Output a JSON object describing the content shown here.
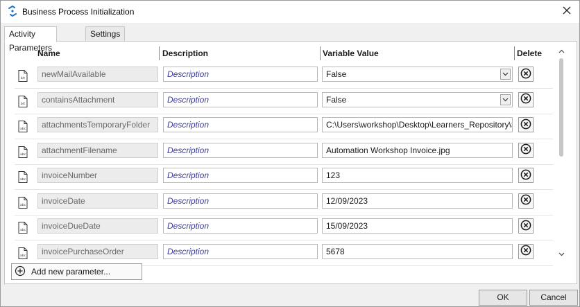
{
  "window": {
    "title": "Business Process Initialization",
    "app_icon": "uipath-arrows-icon",
    "close_icon": "close-icon"
  },
  "tabs": [
    {
      "label": "Activity Parameters",
      "active": true
    },
    {
      "label": "Settings",
      "active": false
    }
  ],
  "table": {
    "headers": {
      "name": "Name",
      "description": "Description",
      "value": "Variable Value",
      "delete": "Delete"
    },
    "rows": [
      {
        "icon": "boolean-file-icon",
        "name": "newMailAvailable",
        "description_placeholder": "Description",
        "value": "False",
        "is_combo": true
      },
      {
        "icon": "boolean-file-icon",
        "name": "containsAttachment",
        "description_placeholder": "Description",
        "value": "False",
        "is_combo": true
      },
      {
        "icon": "string-file-icon",
        "name": "attachmentsTemporaryFolder",
        "description_placeholder": "Description",
        "value": "C:\\Users\\workshop\\Desktop\\Learners_Repository\\S",
        "is_combo": false
      },
      {
        "icon": "string-file-icon",
        "name": "attachmentFilename",
        "description_placeholder": "Description",
        "value": "Automation Workshop Invoice.jpg",
        "is_combo": false
      },
      {
        "icon": "string-file-icon",
        "name": "invoiceNumber",
        "description_placeholder": "Description",
        "value": "123",
        "is_combo": false
      },
      {
        "icon": "string-file-icon",
        "name": "invoiceDate",
        "description_placeholder": "Description",
        "value": "12/09/2023",
        "is_combo": false
      },
      {
        "icon": "string-file-icon",
        "name": "invoiceDueDate",
        "description_placeholder": "Description",
        "value": "15/09/2023",
        "is_combo": false
      },
      {
        "icon": "string-file-icon",
        "name": "invoicePurchaseOrder",
        "description_placeholder": "Description",
        "value": "5678",
        "is_combo": false
      }
    ]
  },
  "add_parameter_label": "Add new parameter...",
  "buttons": {
    "ok": "OK",
    "cancel": "Cancel"
  },
  "colors": {
    "accent": "#1a73c8",
    "description_text": "#3a3a9a"
  }
}
